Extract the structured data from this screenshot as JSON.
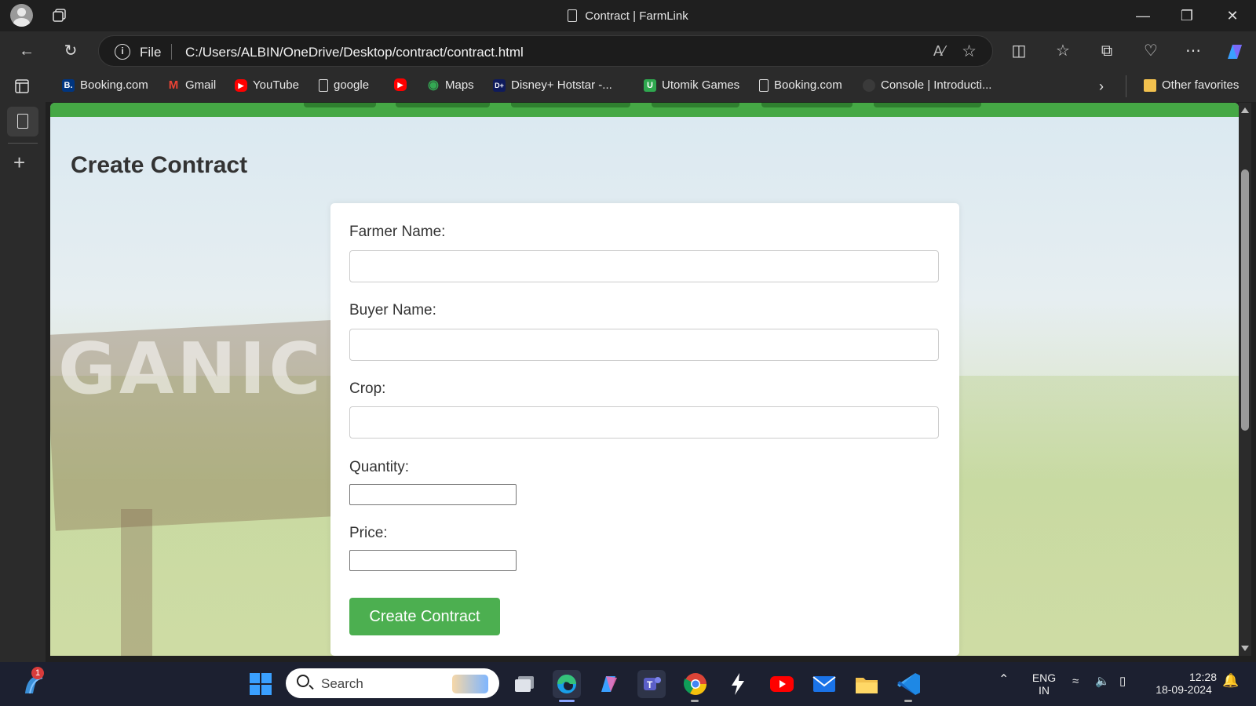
{
  "window": {
    "title": "Contract | FarmLink"
  },
  "address_bar": {
    "scheme_label": "File",
    "url": "C:/Users/ALBIN/OneDrive/Desktop/contract/contract.html"
  },
  "favorites": [
    {
      "label": "Booking.com",
      "icon": "booking-icon",
      "color": "#003580"
    },
    {
      "label": "Gmail",
      "icon": "gmail-icon",
      "color": "#ea4335"
    },
    {
      "label": "YouTube",
      "icon": "youtube-icon",
      "color": "#ff0000"
    },
    {
      "label": "google",
      "icon": "page-icon",
      "color": "#dddddd"
    },
    {
      "label": "",
      "icon": "youtube-icon",
      "color": "#ff0000"
    },
    {
      "label": "Maps",
      "icon": "maps-icon",
      "color": "#34a853"
    },
    {
      "label": "Disney+ Hotstar -...",
      "icon": "hotstar-icon",
      "color": "#0f1b5c"
    },
    {
      "label": "Utomik Games",
      "icon": "utomik-icon",
      "color": "#2fa84f"
    },
    {
      "label": "Booking.com",
      "icon": "page-icon",
      "color": "#dddddd"
    },
    {
      "label": "Console | Introducti...",
      "icon": "console-icon",
      "color": "#3a3a3a"
    },
    {
      "label": "Other favorites",
      "icon": "folder-icon",
      "color": "#f2c14e"
    }
  ],
  "page": {
    "heading": "Create Contract",
    "form": {
      "farmer_label": "Farmer Name:",
      "farmer_value": "",
      "buyer_label": "Buyer Name:",
      "buyer_value": "",
      "crop_label": "Crop:",
      "crop_value": "",
      "quantity_label": "Quantity:",
      "quantity_value": "",
      "price_label": "Price:",
      "price_value": "",
      "submit_label": "Create Contract"
    },
    "background_sign_text": "GANIC ARM",
    "colors": {
      "header_bar": "#45a845",
      "button": "#4caf50"
    }
  },
  "taskbar": {
    "search_placeholder": "Search",
    "notification_count": "1",
    "language": "ENG",
    "region": "IN",
    "time": "12:28",
    "date": "18-09-2024"
  }
}
